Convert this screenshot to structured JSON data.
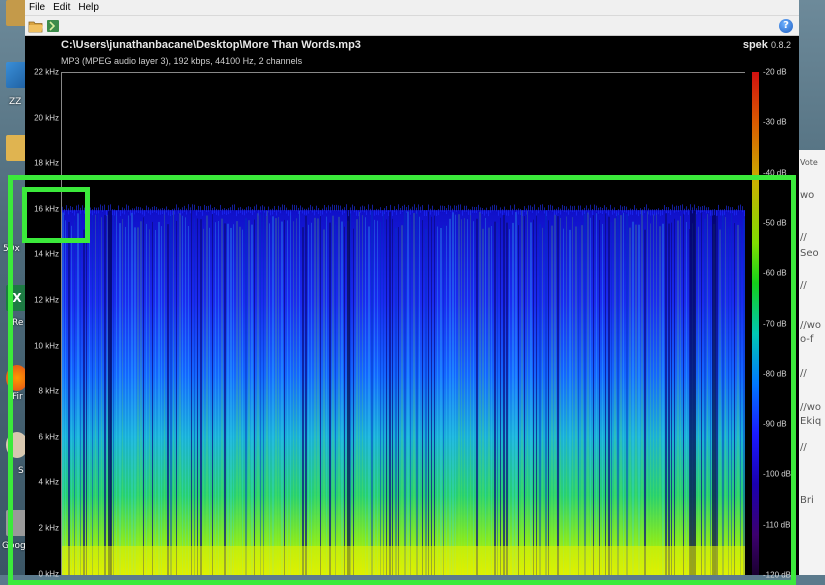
{
  "desktop": {
    "labels": [
      "ZZ",
      "50x",
      "Re",
      "Fir",
      "S",
      "Goog"
    ],
    "right_strip_lines": [
      "Vote",
      "wo",
      "//",
      "Seo",
      "//",
      "//wo",
      "o-f",
      "//",
      "//wo",
      "Ekiq",
      "//",
      "Bri"
    ]
  },
  "menu": {
    "file": "File",
    "edit": "Edit",
    "help": "Help"
  },
  "toolbar": {
    "open_icon": "folder-open-icon",
    "save_icon": "save-icon",
    "help_icon": "help-icon",
    "help_glyph": "?"
  },
  "file_info": {
    "path": "C:\\Users\\junathanbacane\\Desktop\\More Than Words.mp3",
    "details": "MP3 (MPEG audio layer 3), 192 kbps, 44100 Hz, 2 channels"
  },
  "brand": {
    "name": "spek",
    "version": "0.8.2"
  },
  "frequency_axis": {
    "ticks": [
      "22 kHz",
      "20 kHz",
      "18 kHz",
      "16 kHz",
      "14 kHz",
      "12 kHz",
      "10 kHz",
      "8 kHz",
      "6 kHz",
      "4 kHz",
      "2 kHz",
      "0 kHz"
    ],
    "max_khz": 22,
    "cutoff_khz": 16
  },
  "db_axis": {
    "ticks": [
      "-20 dB",
      "-30 dB",
      "-40 dB",
      "-50 dB",
      "-60 dB",
      "-70 dB",
      "-80 dB",
      "-90 dB",
      "-100 dB",
      "-110 dB",
      "-120 dB"
    ]
  },
  "colors": {
    "highlight": "#3bea3b",
    "background": "#000000"
  }
}
